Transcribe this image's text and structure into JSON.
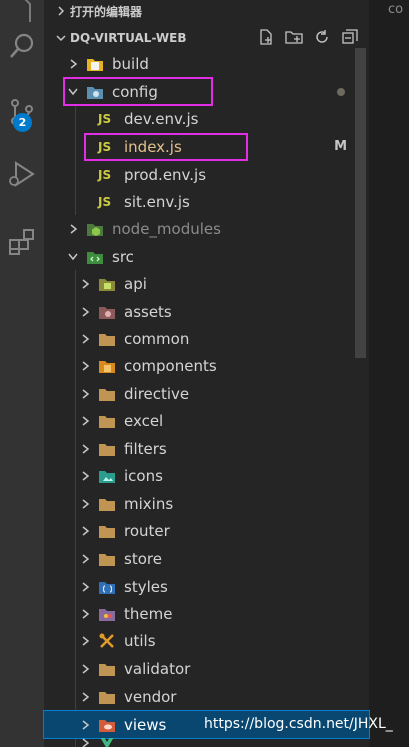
{
  "editor": {
    "tab_text": "co"
  },
  "activity_bar": {
    "icons": [
      "explorer-icon",
      "search-icon",
      "source-control-icon",
      "run-debug-icon",
      "extensions-icon"
    ],
    "scm_badge": "2"
  },
  "open_editors": {
    "label": "打开的编辑器"
  },
  "project": {
    "name": "DQ-VIRTUAL-WEB",
    "actions": [
      "new-file-icon",
      "new-folder-icon",
      "refresh-icon",
      "collapse-all-icon"
    ]
  },
  "tree": {
    "build": {
      "label": "build"
    },
    "config": {
      "label": "config"
    },
    "dev_env": {
      "label": "dev.env.js",
      "icon_text": "JS"
    },
    "index": {
      "label": "index.js",
      "icon_text": "JS",
      "status": "M"
    },
    "prod_env": {
      "label": "prod.env.js",
      "icon_text": "JS"
    },
    "sit_env": {
      "label": "sit.env.js",
      "icon_text": "JS"
    },
    "node_modules": {
      "label": "node_modules"
    },
    "src": {
      "label": "src"
    },
    "api": {
      "label": "api"
    },
    "assets": {
      "label": "assets"
    },
    "common": {
      "label": "common"
    },
    "components": {
      "label": "components"
    },
    "directive": {
      "label": "directive"
    },
    "excel": {
      "label": "excel"
    },
    "filters": {
      "label": "filters"
    },
    "icons": {
      "label": "icons"
    },
    "mixins": {
      "label": "mixins"
    },
    "router": {
      "label": "router"
    },
    "store": {
      "label": "store"
    },
    "styles": {
      "label": "styles"
    },
    "theme": {
      "label": "theme"
    },
    "utils": {
      "label": "utils"
    },
    "validator": {
      "label": "validator"
    },
    "vendor": {
      "label": "vendor"
    },
    "views": {
      "label": "views"
    }
  },
  "watermark": "https://blog.csdn.net/JHXL_",
  "colors": {
    "activity_bg": "#333333",
    "sidebar_bg": "#252526",
    "selection_bg": "#094771",
    "highlight_box": "#e12ee5",
    "js_yellow": "#cbcb41",
    "badge_blue": "#007acc"
  }
}
